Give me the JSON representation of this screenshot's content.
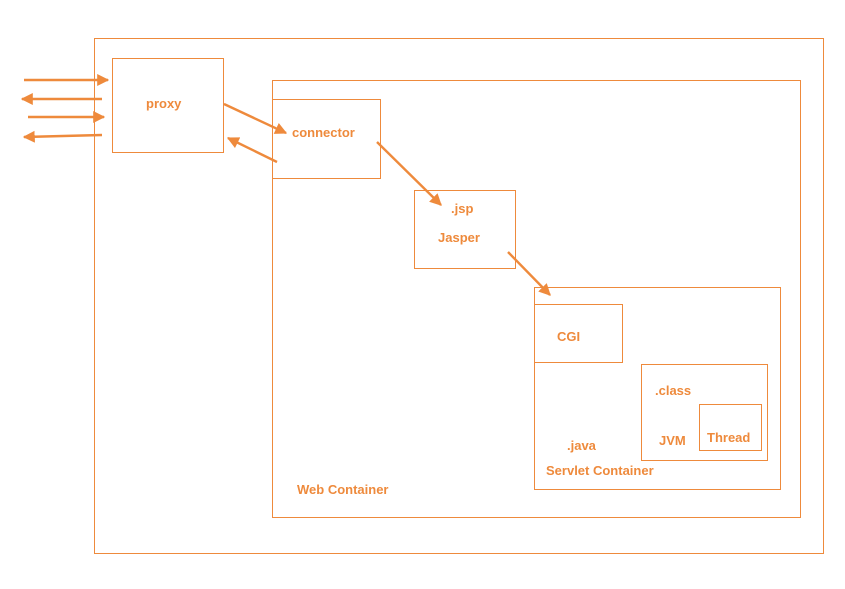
{
  "colors": {
    "stroke": "#ee8a3c"
  },
  "labels": {
    "proxy": "proxy",
    "connector": "connector",
    "jsp": ".jsp",
    "jasper": "Jasper",
    "cgi": "CGI",
    "class": ".class",
    "jvm": "JVM",
    "thread": "Thread",
    "java": ".java",
    "servlet_container": "Servlet  Container",
    "web_container": "Web Container"
  }
}
